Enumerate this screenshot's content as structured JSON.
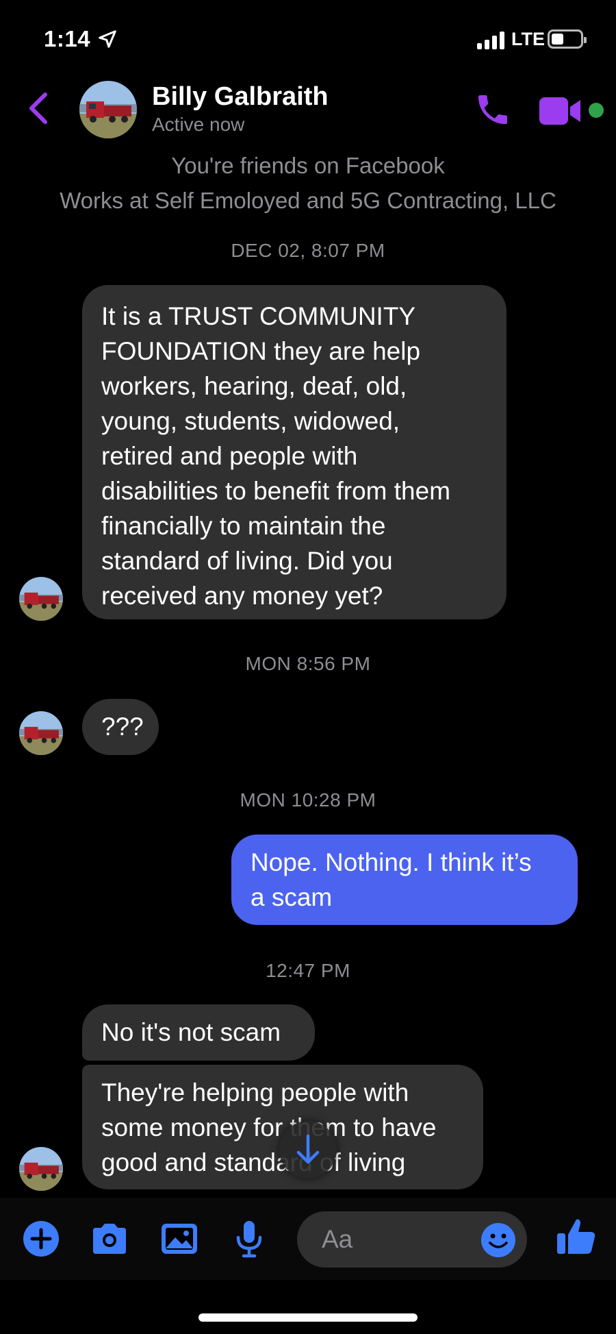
{
  "status_bar": {
    "time": "1:14",
    "network": "LTE"
  },
  "header": {
    "contact_name": "Billy Galbraith",
    "presence": "Active now"
  },
  "profile_info": {
    "friends_line": "You're friends on Facebook",
    "work_line": "Works at Self Emoloyed and 5G Contracting, LLC"
  },
  "timestamps": [
    "DEC 02, 8:07 PM",
    "MON 8:56 PM",
    "MON 10:28 PM",
    "12:47 PM"
  ],
  "messages": [
    {
      "sender": "them",
      "lines": [
        "It is a TRUST COMMUNITY",
        "FOUNDATION they are help",
        "workers, hearing, deaf, old,",
        "young, students, widowed,",
        "retired and people with",
        "disabilities to benefit from them",
        "financially to maintain the",
        "standard of living. Did you",
        "received any money yet?"
      ]
    },
    {
      "sender": "them",
      "lines": [
        "???"
      ]
    },
    {
      "sender": "me",
      "lines": [
        "Nope. Nothing. I think it’s",
        "a scam"
      ]
    },
    {
      "sender": "them",
      "lines": [
        "No it's not scam"
      ]
    },
    {
      "sender": "them",
      "lines": [
        "They're helping people with",
        "some money for them to have",
        "good and standard of living"
      ]
    }
  ],
  "composer": {
    "placeholder": "Aa"
  },
  "icons": {
    "header": [
      "back-chevron-icon",
      "phone-icon",
      "video-camera-icon"
    ],
    "composer": [
      "plus-icon",
      "camera-icon",
      "image-icon",
      "microphone-icon",
      "smiley-icon",
      "thumbs-up-icon"
    ]
  },
  "colors": {
    "accent": "#9b3cf0",
    "my_bubble": "#4c63f0",
    "their_bubble": "#303030",
    "composer_icons": "#3d7dfb",
    "online": "#31a24c"
  }
}
